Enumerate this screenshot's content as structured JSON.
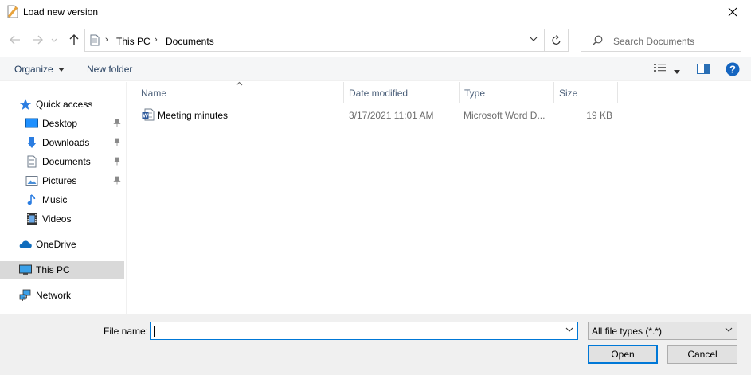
{
  "window": {
    "title": "Load new version",
    "icons": {
      "app": "document-app-icon",
      "close": "close-icon"
    }
  },
  "nav": {
    "breadcrumb": [
      "This PC",
      "Documents"
    ],
    "search_placeholder": "Search Documents",
    "icons": [
      "back-arrow-icon",
      "forward-arrow-icon",
      "recent-dropdown-icon",
      "up-arrow-icon",
      "refresh-icon",
      "search-icon"
    ]
  },
  "toolbar": {
    "organize_label": "Organize",
    "new_folder_label": "New folder"
  },
  "sidebar": {
    "items": [
      {
        "label": "Quick access",
        "icon": "star-icon"
      },
      {
        "label": "Desktop",
        "icon": "desktop-icon",
        "pinned": true
      },
      {
        "label": "Downloads",
        "icon": "download-icon",
        "pinned": true
      },
      {
        "label": "Documents",
        "icon": "documents-icon",
        "pinned": true
      },
      {
        "label": "Pictures",
        "icon": "pictures-icon",
        "pinned": true
      },
      {
        "label": "Music",
        "icon": "music-icon"
      },
      {
        "label": "Videos",
        "icon": "videos-icon"
      },
      {
        "label": "OneDrive",
        "icon": "cloud-icon"
      },
      {
        "label": "This PC",
        "icon": "computer-icon",
        "selected": true
      },
      {
        "label": "Network",
        "icon": "network-icon"
      }
    ]
  },
  "files": {
    "columns": [
      "Name",
      "Date modified",
      "Type",
      "Size"
    ],
    "rows": [
      {
        "name": "Meeting minutes",
        "date": "3/17/2021 11:01 AM",
        "type": "Microsoft Word D...",
        "size": "19 KB"
      }
    ]
  },
  "footer": {
    "file_name_label": "File name:",
    "file_name_value": "",
    "file_type": "All file types (*.*)",
    "open_label": "Open",
    "cancel_label": "Cancel"
  },
  "colors": {
    "accent": "#0078d7",
    "selected_bg": "#d9d9d9",
    "toolbar_bg": "#f5f6f7",
    "footer_bg": "#f0f0f0"
  }
}
